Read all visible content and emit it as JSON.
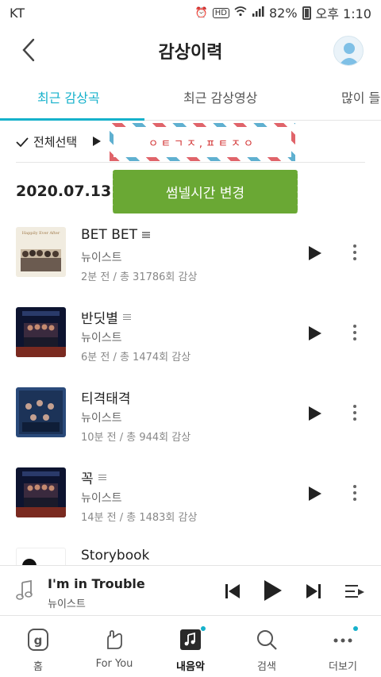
{
  "status_bar": {
    "carrier": "KT",
    "battery": "82%",
    "time": "오후 1:10",
    "hd_label": "HD"
  },
  "header": {
    "title": "감상이력",
    "back_icon": "chevron-left-icon",
    "profile_icon": "user-avatar-icon"
  },
  "tabs": [
    {
      "label": "최근 감상곡",
      "active": true
    },
    {
      "label": "최근 감상영상",
      "active": false
    },
    {
      "label": "많이 들",
      "active": false
    }
  ],
  "toolbar": {
    "select_all_label": "전체선택",
    "play_icon": "play-icon"
  },
  "stamp_text": "ㅇㅌㄱㅈ,ㅍㅌㅈㅇ",
  "date": "2020.07.13",
  "thumbnail_button_label": "썸넬시간 변경",
  "songs": [
    {
      "title": "BET BET",
      "artist": "뉴이스트",
      "meta": "2분 전 / 총 31786회 감상",
      "has_lyrics": true
    },
    {
      "title": "반딧별",
      "artist": "뉴이스트",
      "meta": "6분 전 / 총 1474회 감상",
      "has_lyrics": true
    },
    {
      "title": "티격태격",
      "artist": "뉴이스트",
      "meta": "10분 전 / 총 944회 감상",
      "has_lyrics": false
    },
    {
      "title": "꼭",
      "artist": "뉴이스트",
      "meta": "14분 전 / 총 1483회 감상",
      "has_lyrics": true
    },
    {
      "title": "Storybook",
      "artist": "",
      "meta": "",
      "has_lyrics": false
    }
  ],
  "cover_art_text": "Happily Ever After",
  "now_playing": {
    "title": "I'm in Trouble",
    "artist": "뉴이스트"
  },
  "bottom_nav": [
    {
      "label": "홈",
      "icon": "home-g-icon",
      "active": false
    },
    {
      "label": "For You",
      "icon": "hand-heart-icon",
      "active": false
    },
    {
      "label": "내음악",
      "icon": "my-music-icon",
      "active": true
    },
    {
      "label": "검색",
      "icon": "search-icon",
      "active": false
    },
    {
      "label": "더보기",
      "icon": "more-dots-icon",
      "active": false
    }
  ],
  "colors": {
    "accent": "#16b1cb",
    "button_green": "#6aa834",
    "stamp_red": "#d02828"
  }
}
